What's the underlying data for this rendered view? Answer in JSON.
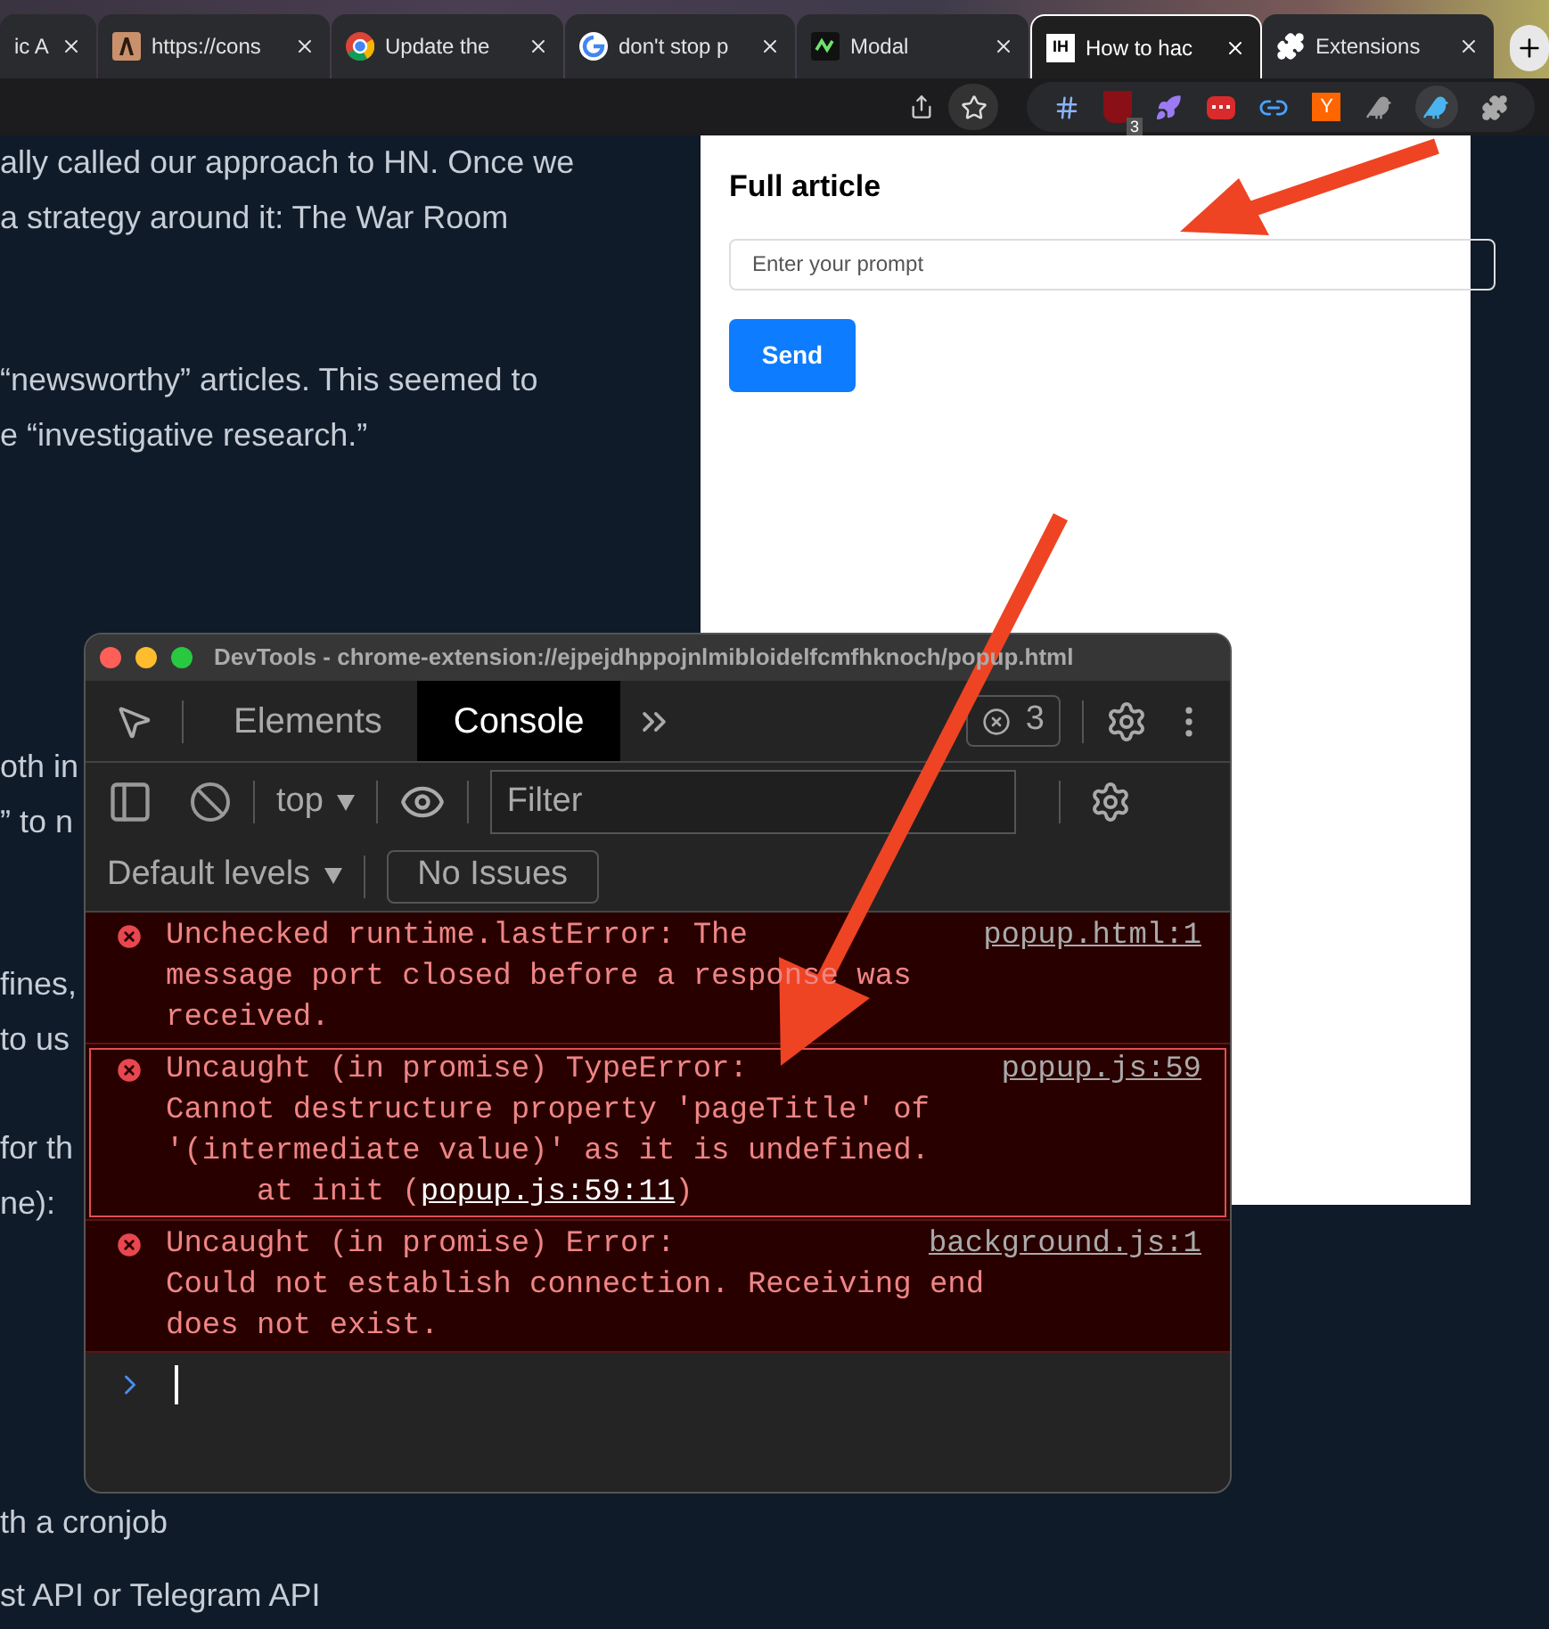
{
  "browser": {
    "tabs": [
      {
        "title": "ic A",
        "selected": false
      },
      {
        "title": "https://cons",
        "kind": "brand",
        "selected": false
      },
      {
        "title": "Update the",
        "kind": "chrome",
        "selected": false
      },
      {
        "title": "don't stop p",
        "kind": "google",
        "selected": false
      },
      {
        "title": "Modal",
        "kind": "modal",
        "selected": false
      },
      {
        "title": "How to hac",
        "kind": "letters",
        "favicon_text": "IH",
        "selected": true
      },
      {
        "title": "Extensions",
        "kind": "puzzle",
        "selected": false
      }
    ],
    "extensions": [
      {
        "kind": "hash"
      },
      {
        "kind": "shield",
        "badge": "3"
      },
      {
        "kind": "rocket"
      },
      {
        "kind": "dots"
      },
      {
        "kind": "link"
      },
      {
        "kind": "letter",
        "text": "Y"
      },
      {
        "kind": "bird"
      },
      {
        "kind": "bird-active"
      },
      {
        "kind": "puzzle"
      }
    ]
  },
  "article": {
    "paragraphs": [
      [
        "ally called our approach to HN. Once we",
        "a strategy around it: The War Room"
      ],
      [
        "“newsworthy” articles. This seemed to",
        "e “investigative research.”"
      ],
      [
        "oth in",
        "” to n"
      ],
      [
        "fines,",
        "to us"
      ],
      [
        "for th",
        "ne):"
      ],
      [
        "th a cronjob"
      ],
      [
        "st API or Telegram API"
      ]
    ]
  },
  "popup": {
    "heading": "Full article",
    "prompt": {
      "placeholder": "Enter your prompt"
    },
    "button": "Send"
  },
  "devtools": {
    "title": "DevTools - chrome-extension://ejpejdhppojnlmibloidelfcmfhknoch/popup.html",
    "tabs": [
      {
        "label": "Elements",
        "selected": false
      },
      {
        "label": "Console",
        "selected": true
      }
    ],
    "error_count": "3",
    "context": "top",
    "filter": {
      "placeholder": "Filter"
    },
    "levels": "Default levels",
    "issues": "No Issues",
    "messages": [
      {
        "title": "Unchecked runtime.lastError: The",
        "text": "message port closed before a response was\nreceived.",
        "source": "popup.html:1",
        "highlighted": false
      },
      {
        "title": "Uncaught (in promise) TypeError:",
        "text": "Cannot destructure property 'pageTitle' of\n'(intermediate value)' as it is undefined.",
        "source": "popup.js:59",
        "trace": {
          "before": "at init (",
          "link": "popup.js:59:11",
          "after": ")"
        },
        "highlighted": true
      },
      {
        "title": "Uncaught (in promise) Error:",
        "text": "Could not establish connection. Receiving end\ndoes not exist.",
        "source": "background.js:1",
        "highlighted": false
      }
    ]
  }
}
